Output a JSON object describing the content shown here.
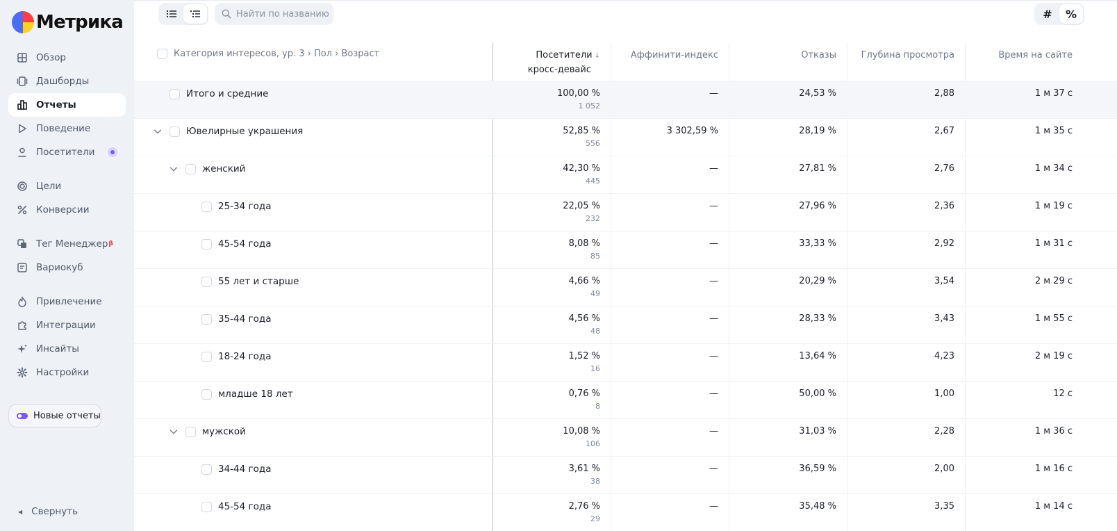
{
  "app": {
    "logo_text": "Метрика"
  },
  "sidebar": {
    "items": [
      {
        "label": "Обзор",
        "icon": "grid-icon"
      },
      {
        "label": "Дашборды",
        "icon": "dashboards-icon"
      },
      {
        "label": "Отчеты",
        "icon": "bar-chart-icon",
        "active": true
      },
      {
        "label": "Поведение",
        "icon": "play-icon"
      },
      {
        "label": "Посетители",
        "icon": "user-icon",
        "badge": true
      },
      {
        "label": "Цели",
        "icon": "target-icon"
      },
      {
        "label": "Конверсии",
        "icon": "percent-icon"
      },
      {
        "label": "Тег Менеджер",
        "icon": "tag-manager-icon",
        "beta": "β"
      },
      {
        "label": "Вариокуб",
        "icon": "variocube-icon"
      },
      {
        "label": "Привлечение",
        "icon": "flame-icon"
      },
      {
        "label": "Интеграции",
        "icon": "puzzle-icon"
      },
      {
        "label": "Инсайты",
        "icon": "sparkle-icon"
      },
      {
        "label": "Настройки",
        "icon": "gear-icon"
      }
    ],
    "new_reports_label": "Новые отчеты",
    "collapse_label": "Свернуть"
  },
  "toolbar": {
    "search_placeholder": "Найти по названию",
    "hash_label": "#",
    "percent_label": "%"
  },
  "table": {
    "dimension_header": "Категория интересов, ур. 3 › Пол › Возраст",
    "columns": [
      {
        "label": "Посетители",
        "label2": "кросс-девайс",
        "sorted": true
      },
      {
        "label": "Аффинити-индекс"
      },
      {
        "label": "Отказы"
      },
      {
        "label": "Глубина просмотра"
      },
      {
        "label": "Время на сайте"
      }
    ],
    "rows": [
      {
        "name": "Итого и средние",
        "level": 0,
        "total": true,
        "expandable": false,
        "visitors": "100,00 %",
        "visitors_abs": "1 052",
        "affinity": "—",
        "bounce": "24,53 %",
        "depth": "2,88",
        "time": "1 м 37 с"
      },
      {
        "name": "Ювелирные украшения",
        "level": 0,
        "expandable": true,
        "visitors": "52,85 %",
        "visitors_abs": "556",
        "affinity": "3 302,59 %",
        "bounce": "28,19 %",
        "depth": "2,67",
        "time": "1 м 35 с"
      },
      {
        "name": "женский",
        "level": 1,
        "expandable": true,
        "visitors": "42,30 %",
        "visitors_abs": "445",
        "affinity": "—",
        "bounce": "27,81 %",
        "depth": "2,76",
        "time": "1 м 34 с"
      },
      {
        "name": "25-34 года",
        "level": 2,
        "expandable": false,
        "visitors": "22,05 %",
        "visitors_abs": "232",
        "affinity": "—",
        "bounce": "27,96 %",
        "depth": "2,36",
        "time": "1 м 19 с"
      },
      {
        "name": "45-54 года",
        "level": 2,
        "expandable": false,
        "visitors": "8,08 %",
        "visitors_abs": "85",
        "affinity": "—",
        "bounce": "33,33 %",
        "depth": "2,92",
        "time": "1 м 31 с"
      },
      {
        "name": "55 лет и старше",
        "level": 2,
        "expandable": false,
        "visitors": "4,66 %",
        "visitors_abs": "49",
        "affinity": "—",
        "bounce": "20,29 %",
        "depth": "3,54",
        "time": "2 м 29 с"
      },
      {
        "name": "35-44 года",
        "level": 2,
        "expandable": false,
        "visitors": "4,56 %",
        "visitors_abs": "48",
        "affinity": "—",
        "bounce": "28,33 %",
        "depth": "3,43",
        "time": "1 м 55 с"
      },
      {
        "name": "18-24 года",
        "level": 2,
        "expandable": false,
        "visitors": "1,52 %",
        "visitors_abs": "16",
        "affinity": "—",
        "bounce": "13,64 %",
        "depth": "4,23",
        "time": "2 м 19 с"
      },
      {
        "name": "младше 18 лет",
        "level": 2,
        "expandable": false,
        "visitors": "0,76 %",
        "visitors_abs": "8",
        "affinity": "—",
        "bounce": "50,00 %",
        "depth": "1,00",
        "time": "12 с"
      },
      {
        "name": "мужской",
        "level": 1,
        "expandable": true,
        "visitors": "10,08 %",
        "visitors_abs": "106",
        "affinity": "—",
        "bounce": "31,03 %",
        "depth": "2,28",
        "time": "1 м 36 с"
      },
      {
        "name": "34-44 года",
        "level": 2,
        "expandable": false,
        "visitors": "3,61 %",
        "visitors_abs": "38",
        "affinity": "—",
        "bounce": "36,59 %",
        "depth": "2,00",
        "time": "1 м 16 с"
      },
      {
        "name": "45-54 года",
        "level": 2,
        "expandable": false,
        "visitors": "2,76 %",
        "visitors_abs": "29",
        "affinity": "—",
        "bounce": "35,48 %",
        "depth": "3,35",
        "time": "1 м 14 с"
      }
    ]
  }
}
